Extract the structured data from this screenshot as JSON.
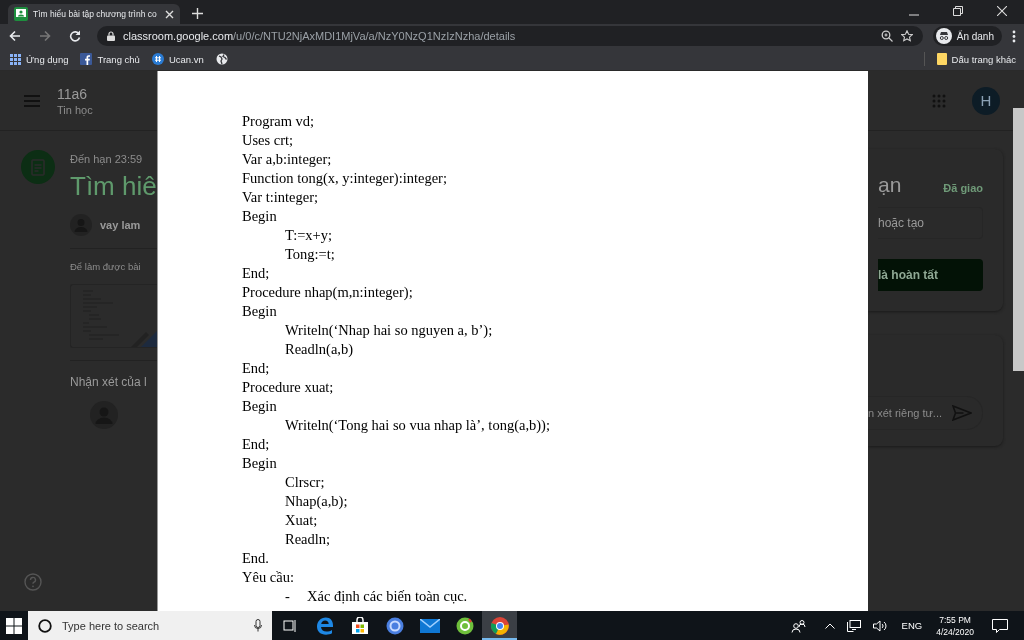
{
  "browser": {
    "tabs": [
      {
        "title": "Tìm hiểu bài tập chương trình co",
        "selected": true
      }
    ],
    "nav": {
      "back_disabled": false,
      "forward_disabled": true
    },
    "address": {
      "host": "classroom.google.com",
      "path": "/u/0/c/NTU2NjAxMDI1MjVa/a/NzY0NzQ1NzIzNzha/details"
    },
    "profile": "Ẩn danh",
    "bookmarks": [
      {
        "kind": "apps",
        "label": "Ứng dụng"
      },
      {
        "kind": "facebook",
        "label": "Trang chủ"
      },
      {
        "kind": "ucan",
        "label": "Ucan.vn"
      },
      {
        "kind": "globe"
      }
    ],
    "other_bookmarks": "Dấu trang khác"
  },
  "classroom": {
    "class_name": "11a6",
    "subject": "Tin học",
    "due": "Đến hạn 23:59",
    "title": "Tìm hiê",
    "author": "vay lam",
    "description": "Để làm được bài",
    "comments_heading": "Nhận xét của l",
    "avatar": "H",
    "work_title": "ạn",
    "status": "Đã giao",
    "add_button": "hoặc tạo",
    "done_button": "là hoàn tất",
    "private_comment_placeholder": "n xét riêng tư..."
  },
  "document": {
    "lines": [
      {
        "kind": "plain",
        "text": "Program vd;"
      },
      {
        "kind": "plain",
        "text": "Uses crt;"
      },
      {
        "kind": "plain",
        "text": "Var a,b:integer;"
      },
      {
        "kind": "plain",
        "text": "Function tong(x, y:integer):integer;"
      },
      {
        "kind": "plain",
        "text": "Var t:integer;"
      },
      {
        "kind": "plain",
        "text": "Begin"
      },
      {
        "kind": "indented",
        "text": "T:=x+y;"
      },
      {
        "kind": "indented",
        "text": "Tong:=t;"
      },
      {
        "kind": "plain",
        "text": "End;"
      },
      {
        "kind": "plain",
        "text": "Procedure nhap(m,n:integer);"
      },
      {
        "kind": "plain",
        "text": "Begin"
      },
      {
        "kind": "indented",
        "text": "Writeln(‘Nhap hai so nguyen a, b’);"
      },
      {
        "kind": "indented",
        "text": "Readln(a,b)"
      },
      {
        "kind": "plain",
        "text": "End;"
      },
      {
        "kind": "plain",
        "text": "Procedure xuat;"
      },
      {
        "kind": "plain",
        "text": "Begin"
      },
      {
        "kind": "indented",
        "text": "Writeln(‘Tong hai so vua nhap là’, tong(a,b));"
      },
      {
        "kind": "plain",
        "text": "End;"
      },
      {
        "kind": "plain",
        "text": "Begin"
      },
      {
        "kind": "indented",
        "text": "Clrscr;"
      },
      {
        "kind": "indented",
        "text": "Nhap(a,b);"
      },
      {
        "kind": "indented",
        "text": "Xuat;"
      },
      {
        "kind": "indented",
        "text": "Readln;"
      },
      {
        "kind": "plain",
        "text": "End."
      },
      {
        "kind": "plain",
        "text": "Yêu cầu:"
      },
      {
        "kind": "bullet",
        "marker": "-",
        "text": "Xác định các biến toàn cục."
      }
    ]
  },
  "taskbar": {
    "search_placeholder": "Type here to search",
    "apps": [
      {
        "kind": "taskview",
        "selected": false
      },
      {
        "kind": "edge",
        "selected": false
      },
      {
        "kind": "store",
        "selected": false
      },
      {
        "kind": "bluecircle",
        "selected": false
      },
      {
        "kind": "mail",
        "selected": false
      },
      {
        "kind": "green",
        "selected": false
      },
      {
        "kind": "chrome",
        "selected": true
      }
    ],
    "language": "ENG",
    "time": "7:55 PM",
    "date": "4/24/2020"
  }
}
